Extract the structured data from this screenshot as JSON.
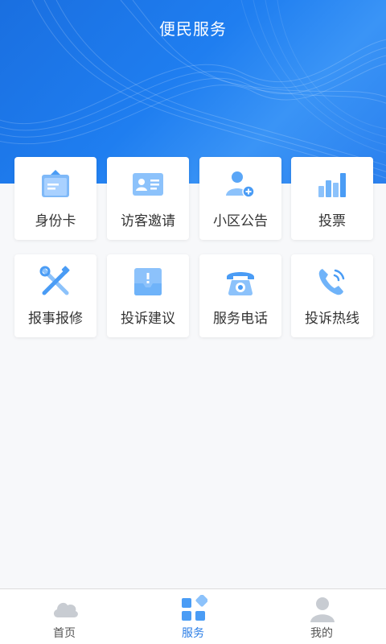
{
  "header": {
    "title": "便民服务"
  },
  "services": [
    {
      "label": "身份卡",
      "icon": "id-card-icon"
    },
    {
      "label": "访客邀请",
      "icon": "visitor-card-icon"
    },
    {
      "label": "小区公告",
      "icon": "user-add-icon"
    },
    {
      "label": "投票",
      "icon": "bar-chart-icon"
    },
    {
      "label": "报事报修",
      "icon": "tools-icon"
    },
    {
      "label": "投诉建议",
      "icon": "complaint-box-icon"
    },
    {
      "label": "服务电话",
      "icon": "telephone-icon"
    },
    {
      "label": "投诉热线",
      "icon": "phone-call-icon"
    }
  ],
  "tabbar": {
    "items": [
      {
        "label": "首页",
        "icon": "cloud-icon",
        "active": false
      },
      {
        "label": "服务",
        "icon": "grid-apps-icon",
        "active": true
      },
      {
        "label": "我的",
        "icon": "user-icon",
        "active": false
      }
    ]
  },
  "colors": {
    "primary": "#1f7ef0",
    "icon_light": "#a9d1ff",
    "icon_dark": "#4a9cf5",
    "inactive_icon": "#c8ccd2"
  }
}
